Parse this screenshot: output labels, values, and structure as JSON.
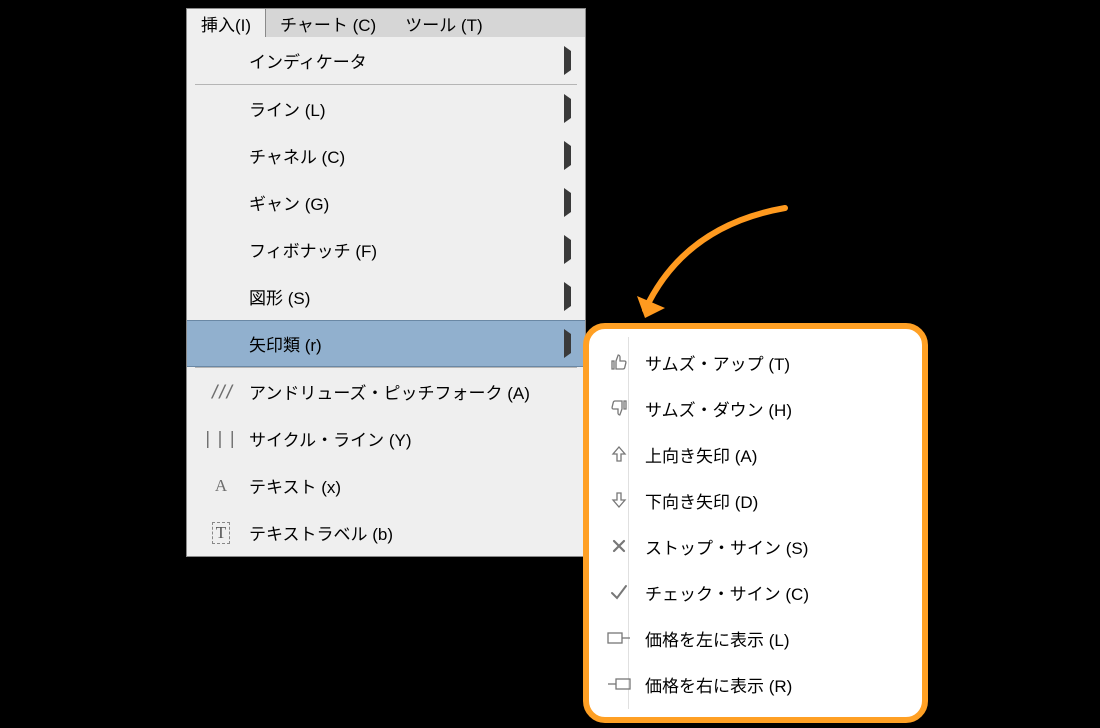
{
  "menubar": {
    "tabs": [
      {
        "label": "挿入(I)"
      },
      {
        "label": "チャート (C)"
      },
      {
        "label": "ツール (T)"
      }
    ],
    "activeIndex": 0
  },
  "dropdown": {
    "groups": [
      {
        "items": [
          {
            "label": "インディケータ",
            "hasSubmenu": true
          }
        ]
      },
      {
        "items": [
          {
            "label": "ライン (L)",
            "hasSubmenu": true
          },
          {
            "label": "チャネル (C)",
            "hasSubmenu": true
          },
          {
            "label": "ギャン (G)",
            "hasSubmenu": true
          },
          {
            "label": "フィボナッチ (F)",
            "hasSubmenu": true
          },
          {
            "label": "図形 (S)",
            "hasSubmenu": true
          },
          {
            "label": "矢印類 (r)",
            "hasSubmenu": true,
            "highlight": true
          }
        ]
      },
      {
        "items": [
          {
            "label": "アンドリューズ・ピッチフォーク (A)",
            "icon": "pitchfork"
          },
          {
            "label": "サイクル・ライン (Y)",
            "icon": "cycle"
          },
          {
            "label": "テキスト (x)",
            "icon": "letter-a"
          },
          {
            "label": "テキストラベル (b)",
            "icon": "letter-t"
          }
        ]
      }
    ]
  },
  "submenu": {
    "items": [
      {
        "label": "サムズ・アップ (T)",
        "icon": "thumbs-up"
      },
      {
        "label": "サムズ・ダウン (H)",
        "icon": "thumbs-down"
      },
      {
        "label": "上向き矢印 (A)",
        "icon": "arrow-up"
      },
      {
        "label": "下向き矢印 (D)",
        "icon": "arrow-down"
      },
      {
        "label": "ストップ・サイン (S)",
        "icon": "stop"
      },
      {
        "label": "チェック・サイン (C)",
        "icon": "check"
      },
      {
        "label": "価格を左に表示 (L)",
        "icon": "price-left"
      },
      {
        "label": "価格を右に表示 (R)",
        "icon": "price-right"
      }
    ]
  }
}
